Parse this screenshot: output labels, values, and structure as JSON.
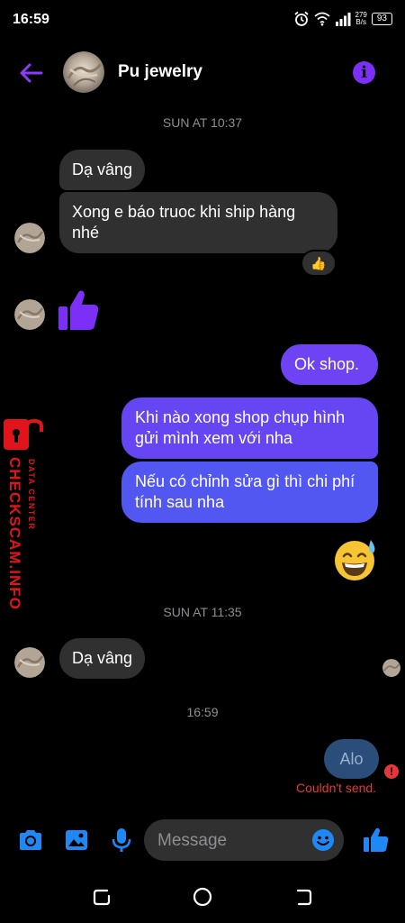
{
  "status": {
    "time": "16:59",
    "net_speed_value": "279",
    "net_speed_unit": "B/s",
    "battery": "93"
  },
  "header": {
    "contact_name": "Pu jewelry",
    "icons": [
      "back-arrow-icon",
      "info-icon"
    ]
  },
  "thread": {
    "timestamps": [
      "SUN AT 10:37",
      "SUN AT 11:35",
      "16:59"
    ],
    "messages": [
      {
        "from": "them",
        "text": "Dạ vâng"
      },
      {
        "from": "them",
        "text": "Xong e báo truoc khi ship hàng nhé",
        "reaction": "👍"
      },
      {
        "from": "them",
        "sticker": "like-thumb-icon"
      },
      {
        "from": "me",
        "text": "Ok shop."
      },
      {
        "from": "me",
        "text": "Khi nào xong shop chụp hình gửi mình xem với nha"
      },
      {
        "from": "me",
        "text": "Nếu có chỉnh sửa gì thì chi phí tính sau nha"
      },
      {
        "from": "me",
        "emoji": "😅"
      },
      {
        "from": "them",
        "text": "Dạ vâng"
      },
      {
        "from": "me",
        "text": "Alo",
        "status": "Couldn't send."
      }
    ]
  },
  "watermark": {
    "main": "CHECKSCAM.INFO",
    "sub": "DATA CENTER"
  },
  "composer": {
    "placeholder": "Message",
    "icons": [
      "camera-icon",
      "gallery-icon",
      "mic-icon",
      "emoji-icon",
      "like-icon"
    ]
  },
  "colors": {
    "accent": "#7b2ff7",
    "outgoing_top": "#7443f3",
    "outgoing_bottom": "#4f5ff2",
    "incoming": "#303030",
    "error": "#e5383b",
    "watermark": "#e0151b",
    "composer_icons": "#1e88f5"
  }
}
